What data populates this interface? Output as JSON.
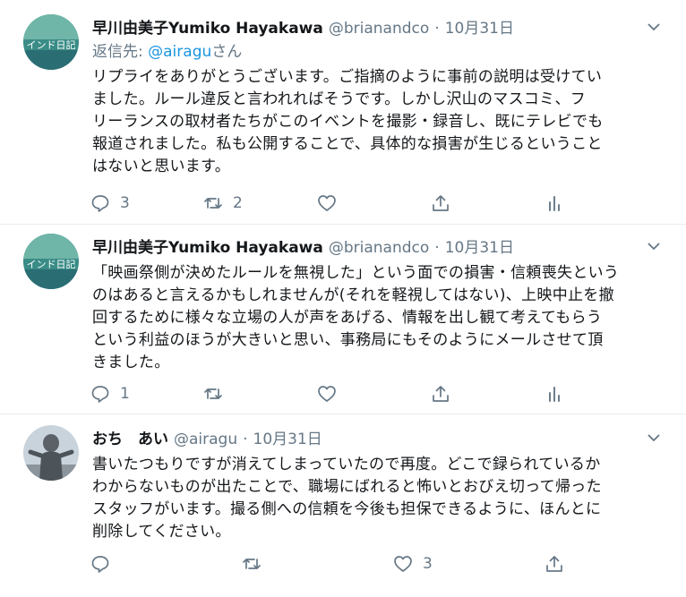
{
  "tweets": [
    {
      "name": "早川由美子Yumiko Hayakawa",
      "handle": "@brianandco",
      "dot": "·",
      "date": "10月31日",
      "reply_prefix": "返信先: ",
      "reply_to": "@airagu",
      "reply_suffix": "さん",
      "lines": [
        "リプライをありがとうございます。ご指摘のように事前の説明は受けてい",
        "ました。ルール違反と言われればそうです。しかし沢山のマスコミ、フ",
        "リーランスの取材者たちがこのイベントを撮影・録音し、既にテレビでも",
        "報道されました。私も公開することで、具体的な損害が生じるということ",
        "はないと思います。"
      ],
      "reply_count": "3",
      "retweet_count": "2",
      "like_count": "",
      "avatar_text": "インド日記"
    },
    {
      "name": "早川由美子Yumiko Hayakawa",
      "handle": "@brianandco",
      "dot": "·",
      "date": "10月31日",
      "lines": [
        "「映画祭側が決めたルールを無視した」という面での損害・信頼喪失という",
        "のはあると言えるかもしれませんが(それを軽視してはない)、上映中止を撤",
        "回するために様々な立場の人が声をあげる、情報を出し観て考えてもらう",
        "という利益のほうが大きいと思い、事務局にもそのようにメールさせて頂",
        "きました。"
      ],
      "reply_count": "1",
      "retweet_count": "",
      "like_count": "",
      "avatar_text": "インド日記"
    },
    {
      "name": "おち　あい",
      "handle": "@airagu",
      "dot": "·",
      "date": "10月31日",
      "lines": [
        "書いたつもりですが消えてしまっていたので再度。どこで録られているか",
        "わからないものが出たことで、職場にばれると怖いとおびえ切って帰った",
        "スタッフがいます。撮る側への信頼を今後も担保できるように、ほんとに",
        "削除してください。"
      ],
      "reply_count": "",
      "retweet_count": "",
      "like_count": "3"
    }
  ],
  "colors": {
    "text": "#14171a",
    "muted": "#657786",
    "link": "#1b95e0",
    "divider": "#e6ecf0"
  }
}
